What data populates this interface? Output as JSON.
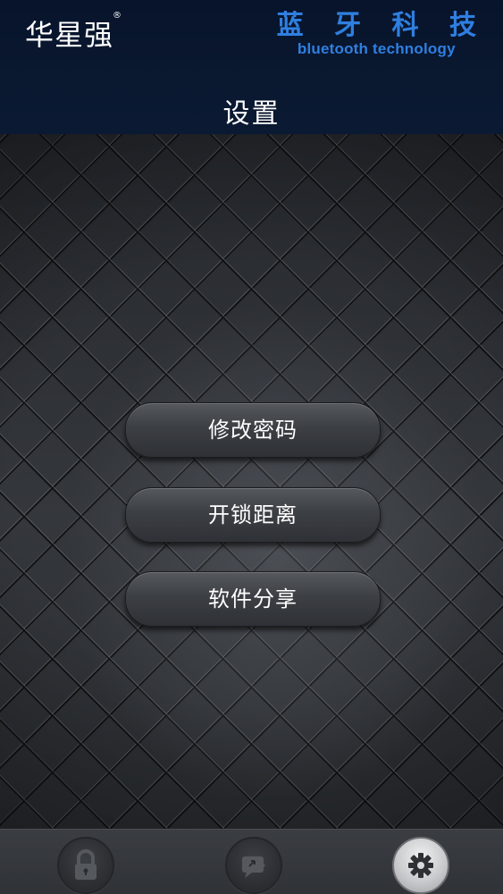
{
  "header": {
    "brand_left": "华星强",
    "brand_left_mark": "®",
    "brand_right_cn": "蓝 牙 科 技",
    "brand_right_en": "bluetooth technology",
    "title": "设置",
    "brand_right_color": "#2f7fe0"
  },
  "menu": {
    "items": [
      {
        "label": "修改密码"
      },
      {
        "label": "开锁距离"
      },
      {
        "label": "软件分享"
      }
    ]
  },
  "tabbar": {
    "tabs": [
      {
        "icon": "lock-icon",
        "active": false
      },
      {
        "icon": "share-icon",
        "active": false
      },
      {
        "icon": "gear-icon",
        "active": true
      }
    ]
  }
}
